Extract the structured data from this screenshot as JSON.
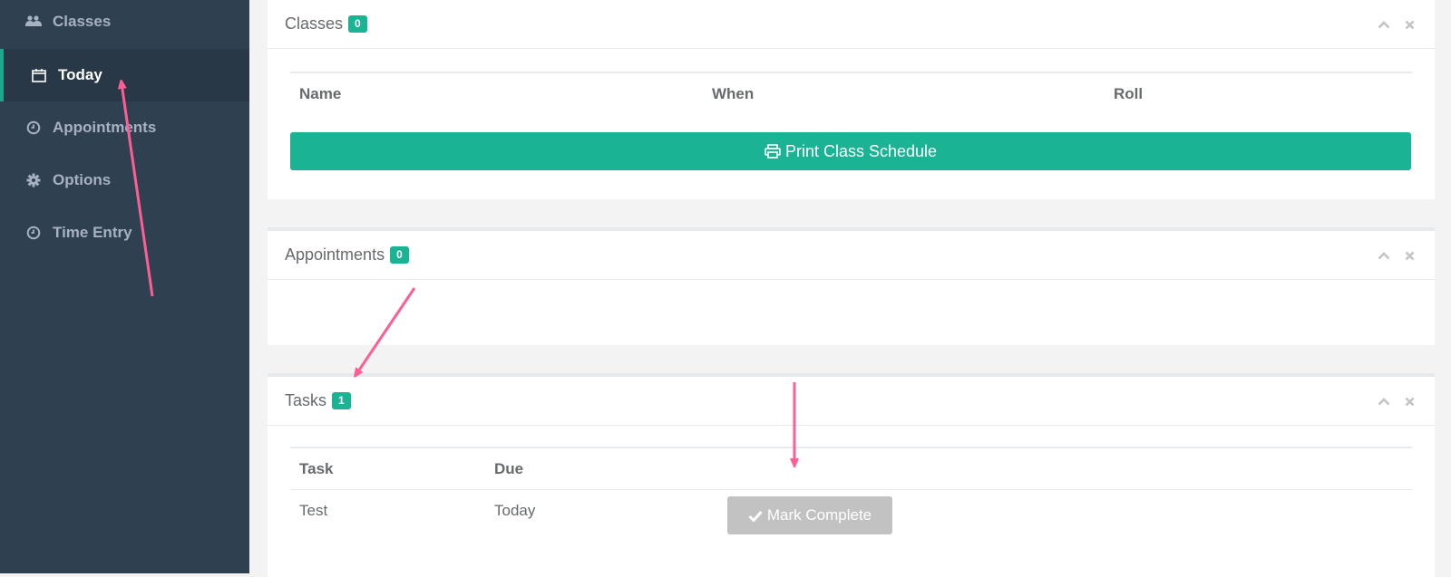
{
  "sidebar": {
    "items": [
      {
        "label": "Classes",
        "icon": "users-icon"
      },
      {
        "label": "Today",
        "icon": "calendar-icon",
        "active": true
      },
      {
        "label": "Appointments",
        "icon": "clock-icon"
      },
      {
        "label": "Options",
        "icon": "gear-icon"
      },
      {
        "label": "Time Entry",
        "icon": "clock-icon"
      }
    ]
  },
  "classes_panel": {
    "title": "Classes",
    "count": "0",
    "columns": [
      "Name",
      "When",
      "Roll"
    ],
    "print_button": "Print Class Schedule"
  },
  "appointments_panel": {
    "title": "Appointments",
    "count": "0"
  },
  "tasks_panel": {
    "title": "Tasks",
    "count": "1",
    "columns": [
      "Task",
      "Due"
    ],
    "rows": [
      {
        "task": "Test",
        "due": "Today",
        "action": "Mark Complete"
      }
    ]
  },
  "colors": {
    "sidebar_bg": "#2f4050",
    "accent": "#1ab394",
    "annotation": "#ff5e94"
  }
}
